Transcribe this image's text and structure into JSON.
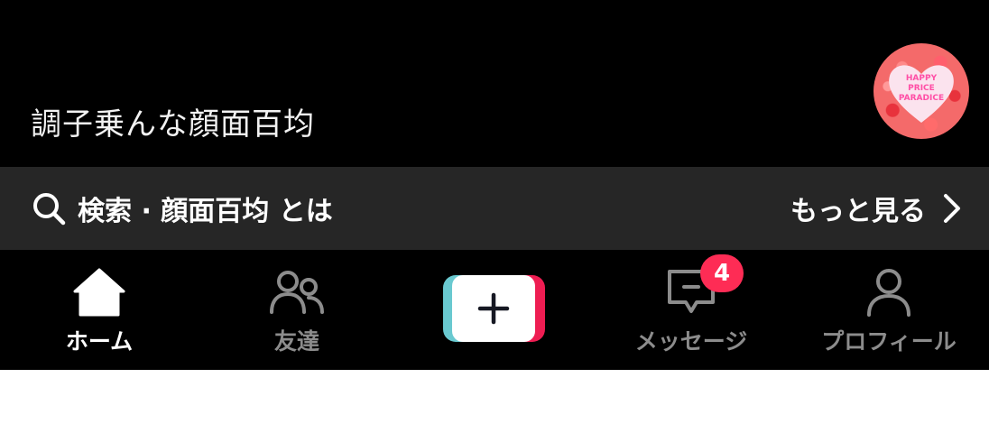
{
  "video": {
    "caption": "調子乗んな顔面百均",
    "sound_disc": {
      "text_lines": [
        "HAPPY",
        "PRICE",
        "PARADICE"
      ],
      "colors": {
        "background": "#f46a6a",
        "heart": "#fbe3ee",
        "text": "#ff4fa6"
      }
    }
  },
  "search": {
    "icon": "search-icon",
    "text": "検索 · 顔面百均 とは",
    "more_label": "もっと見る",
    "more_icon": "chevron-right-icon"
  },
  "tabs": [
    {
      "id": "home",
      "label": "ホーム",
      "icon": "home-icon",
      "active": true
    },
    {
      "id": "friends",
      "label": "友達",
      "icon": "friends-icon",
      "active": false
    },
    {
      "id": "create",
      "label": "",
      "icon": "plus-icon",
      "active": false
    },
    {
      "id": "inbox",
      "label": "メッセージ",
      "icon": "message-icon",
      "active": false,
      "badge": "4"
    },
    {
      "id": "profile",
      "label": "プロフィール",
      "icon": "profile-icon",
      "active": false
    }
  ],
  "colors": {
    "background": "#000000",
    "search_bar": "#262626",
    "active_label": "#ffffff",
    "inactive_label": "#8c8c8c",
    "badge": "#fe2c55",
    "create_cyan": "#69c9d0",
    "create_red": "#ee1d52"
  }
}
